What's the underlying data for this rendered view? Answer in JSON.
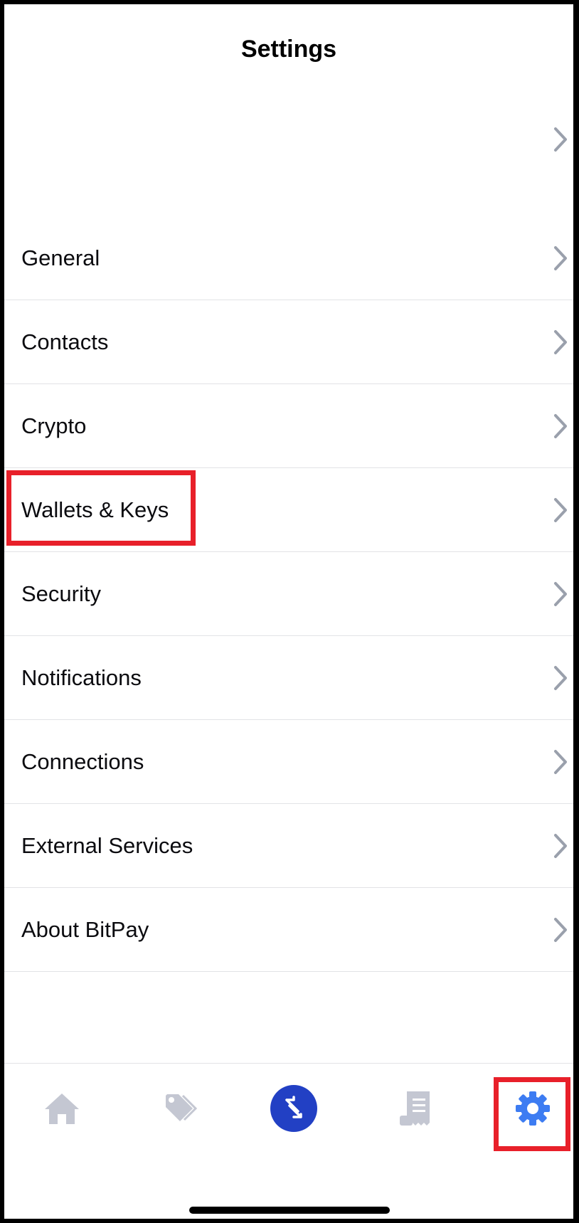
{
  "header": {
    "title": "Settings"
  },
  "menu": {
    "items": [
      {
        "label": "General"
      },
      {
        "label": "Contacts"
      },
      {
        "label": "Crypto"
      },
      {
        "label": "Wallets & Keys"
      },
      {
        "label": "Security"
      },
      {
        "label": "Notifications"
      },
      {
        "label": "Connections"
      },
      {
        "label": "External Services"
      },
      {
        "label": "About BitPay"
      }
    ]
  },
  "tabbar": {
    "tabs": [
      {
        "icon": "home-icon",
        "active": false
      },
      {
        "icon": "tag-icon",
        "active": false
      },
      {
        "icon": "transact-icon",
        "active": false
      },
      {
        "icon": "receipt-icon",
        "active": false
      },
      {
        "icon": "gear-icon",
        "active": true
      }
    ]
  },
  "colors": {
    "accent": "#2240c4",
    "active_tab": "#3d7cf2",
    "inactive_tab": "#c4c7d2",
    "chevron": "#9aa0ac",
    "highlight": "#e8202a",
    "divider": "#e2e3e6"
  }
}
